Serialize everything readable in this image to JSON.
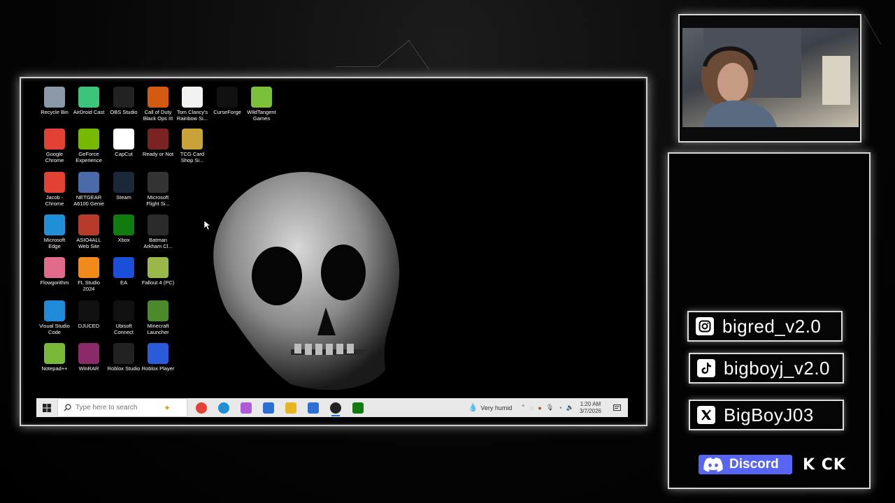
{
  "desktop": {
    "icons": [
      {
        "label": "Recycle Bin",
        "icon": "recycle-bin-icon",
        "color": "#8a9aa8"
      },
      {
        "label": "AirDroid Cast",
        "icon": "airdroid-icon",
        "color": "#3bc47a"
      },
      {
        "label": "OBS Studio",
        "icon": "obs-icon",
        "color": "#222222"
      },
      {
        "label": "Call of Duty\nBlack Ops III",
        "icon": "cod-icon",
        "color": "#d45a12"
      },
      {
        "label": "Tom Clancy's\nRainbow Si...",
        "icon": "file-icon",
        "color": "#f2f2f2"
      },
      {
        "label": "CurseForge",
        "icon": "curseforge-icon",
        "color": "#111111"
      },
      {
        "label": "WildTangent\nGames",
        "icon": "wildtangent-icon",
        "color": "#7bbf3a"
      },
      {
        "label": "Google\nChrome",
        "icon": "chrome-icon",
        "color": "#e34133"
      },
      {
        "label": "GeForce\nExperience",
        "icon": "geforce-icon",
        "color": "#76b900"
      },
      {
        "label": "CapCut",
        "icon": "capcut-icon",
        "color": "#ffffff"
      },
      {
        "label": "Ready or Not",
        "icon": "ready-or-not-icon",
        "color": "#7a2222"
      },
      {
        "label": "TCG Card\nShop Si...",
        "icon": "tcg-icon",
        "color": "#c9a23a"
      },
      {
        "label": "Jacob -\nChrome",
        "icon": "chrome-profile-icon",
        "color": "#e34133"
      },
      {
        "label": "NETGEAR\nA6100 Genie",
        "icon": "netgear-icon",
        "color": "#4a6aa8"
      },
      {
        "label": "Steam",
        "icon": "steam-icon",
        "color": "#1b2838"
      },
      {
        "label": "Microsoft\nFlight Si...",
        "icon": "flight-sim-icon",
        "color": "#333333"
      },
      {
        "label": "Microsoft\nEdge",
        "icon": "edge-icon",
        "color": "#1f8fd8"
      },
      {
        "label": "ASIO4ALL\nWeb Site",
        "icon": "asio-icon",
        "color": "#b83a2a"
      },
      {
        "label": "Xbox",
        "icon": "xbox-icon",
        "color": "#107c10"
      },
      {
        "label": "Batman\nArkham Cl...",
        "icon": "batman-icon",
        "color": "#2b2b2b"
      },
      {
        "label": "Flowgorithm",
        "icon": "flowgorithm-icon",
        "color": "#e06a8a"
      },
      {
        "label": "FL Studio\n2024",
        "icon": "fl-studio-icon",
        "color": "#f08a1a"
      },
      {
        "label": "EA",
        "icon": "ea-icon",
        "color": "#1a4fd8"
      },
      {
        "label": "Fallout 4 (PC)",
        "icon": "fallout-icon",
        "color": "#9ab84a"
      },
      {
        "label": "Visual Studio\nCode",
        "icon": "vscode-icon",
        "color": "#1f8ad8"
      },
      {
        "label": "DJUCED",
        "icon": "djuced-icon",
        "color": "#111111"
      },
      {
        "label": "Ubisoft\nConnect",
        "icon": "ubisoft-icon",
        "color": "#111111"
      },
      {
        "label": "Minecraft\nLauncher",
        "icon": "minecraft-icon",
        "color": "#4a8a2a"
      },
      {
        "label": "Notepad++",
        "icon": "notepadpp-icon",
        "color": "#7ab83a"
      },
      {
        "label": "WinRAR",
        "icon": "winrar-icon",
        "color": "#8a2a6a"
      },
      {
        "label": "Roblox Studio",
        "icon": "roblox-studio-icon",
        "color": "#222222"
      },
      {
        "label": "Roblox Player",
        "icon": "roblox-player-icon",
        "color": "#2b5bd8"
      }
    ]
  },
  "taskbar": {
    "search_placeholder": "Type here to search",
    "apps": [
      "chrome-icon",
      "edge-icon",
      "copilot-icon",
      "outlook-icon",
      "file-explorer-icon",
      "store-icon",
      "obs-icon",
      "xbox-icon"
    ],
    "weather": "Very humid",
    "clock_time": "1:20 AM",
    "clock_date": "3/7/2026"
  },
  "socials": {
    "instagram": "bigred_v2.0",
    "tiktok": "bigboyj_v2.0",
    "x": "BigBoyJ03",
    "discord": "Discord",
    "kick": "K CK"
  }
}
